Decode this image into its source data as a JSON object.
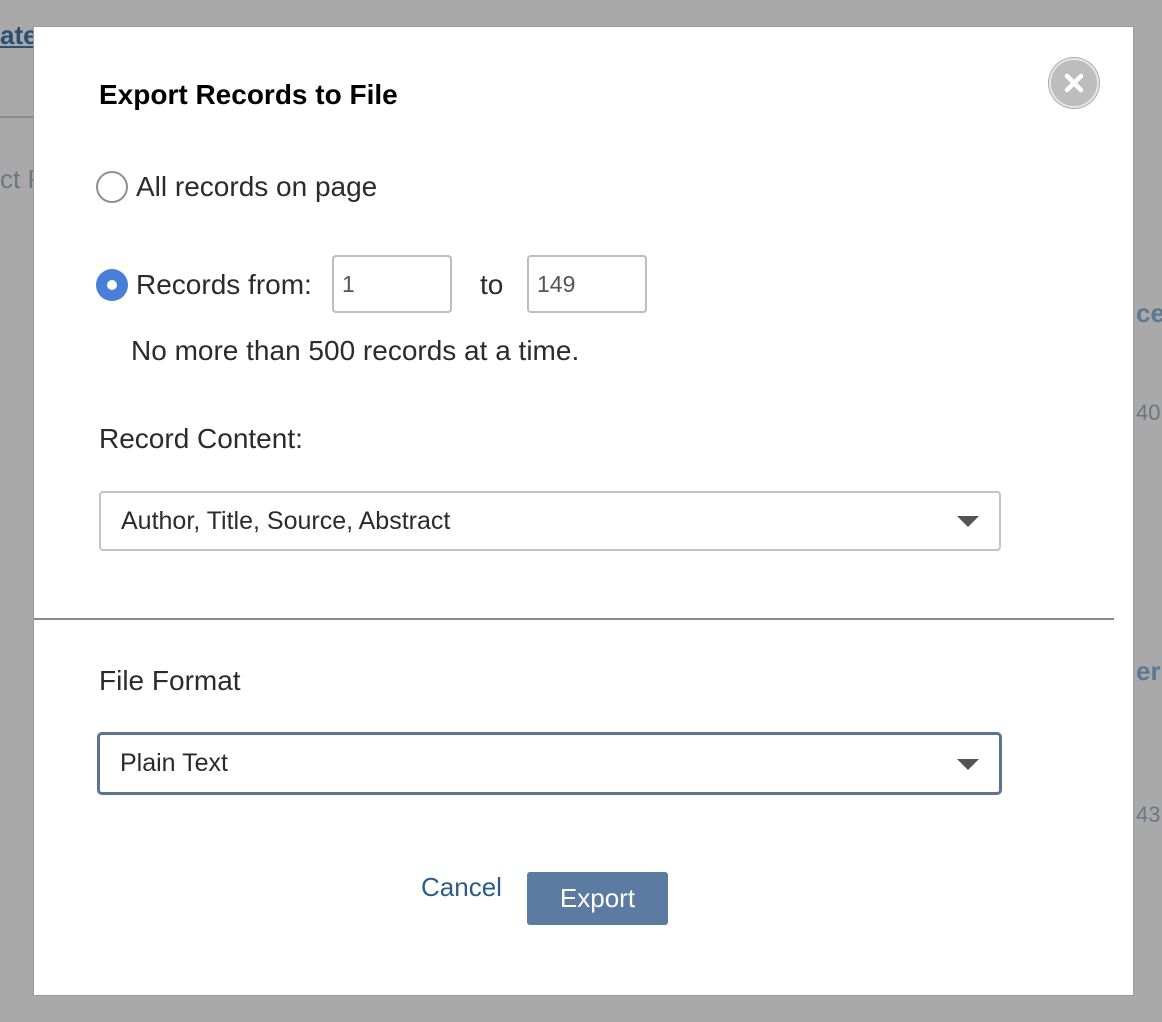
{
  "background": {
    "frag_top_left": "ate",
    "frag_left": "ct P",
    "frag_right_1": "ce",
    "frag_right_2": "40",
    "frag_right_3": "er",
    "frag_right_4": "43"
  },
  "modal": {
    "title": "Export Records to File",
    "close_icon": "close-x-icon",
    "range": {
      "option_all_label": "All records on page",
      "option_from_label": "Records from:",
      "from_value": "1",
      "to_label": "to",
      "to_value": "149",
      "limit_hint": "No more than 500 records at a time."
    },
    "record_content": {
      "label": "Record Content:",
      "selected": "Author, Title, Source, Abstract"
    },
    "file_format": {
      "label": "File Format",
      "selected": "Plain Text"
    },
    "actions": {
      "cancel_label": "Cancel",
      "export_label": "Export"
    }
  },
  "colors": {
    "accent_radio": "#4a7fd9",
    "export_button": "#5b7ba0",
    "link": "#2b5d88"
  }
}
